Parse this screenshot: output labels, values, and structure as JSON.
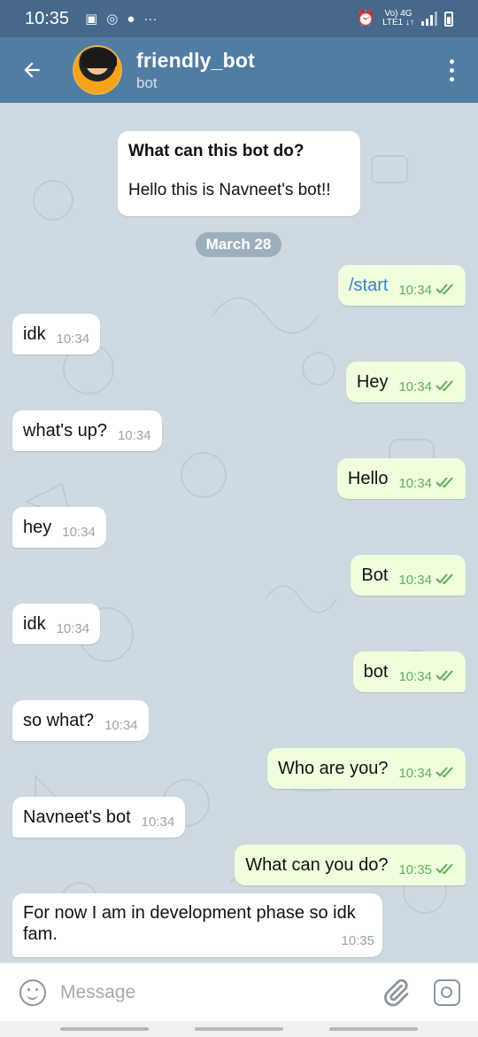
{
  "status_bar": {
    "time": "10:35",
    "network_top": "Vo) 4G",
    "network_bottom": "LTE1 ↓↑"
  },
  "header": {
    "title": "friendly_bot",
    "subtitle": "bot"
  },
  "info_card": {
    "question": "What can this bot do?",
    "answer": "Hello this is Navneet's bot!!"
  },
  "date_separator": "March 28",
  "messages": [
    {
      "text": "/start",
      "time": "10:34",
      "dir": "out"
    },
    {
      "text": "idk",
      "time": "10:34",
      "dir": "in"
    },
    {
      "text": "Hey",
      "time": "10:34",
      "dir": "out"
    },
    {
      "text": "what's up?",
      "time": "10:34",
      "dir": "in"
    },
    {
      "text": "Hello",
      "time": "10:34",
      "dir": "out"
    },
    {
      "text": "hey",
      "time": "10:34",
      "dir": "in"
    },
    {
      "text": "Bot",
      "time": "10:34",
      "dir": "out"
    },
    {
      "text": "idk",
      "time": "10:34",
      "dir": "in"
    },
    {
      "text": "bot",
      "time": "10:34",
      "dir": "out"
    },
    {
      "text": "so what?",
      "time": "10:34",
      "dir": "in"
    },
    {
      "text": "Who are you?",
      "time": "10:34",
      "dir": "out"
    },
    {
      "text": "Navneet's bot",
      "time": "10:34",
      "dir": "in"
    },
    {
      "text": "What can you do?",
      "time": "10:35",
      "dir": "out"
    },
    {
      "text": "For now I am in development phase so idk fam.",
      "time": "10:35",
      "dir": "in"
    }
  ],
  "composer": {
    "placeholder": "Message"
  },
  "colors": {
    "status_bar": "#46688a",
    "app_bar": "#517da2",
    "chat_bg": "#cfd9e2",
    "outgoing_bubble": "#effedd",
    "incoming_bubble": "#ffffff",
    "read_ticks": "#5fae62",
    "command_link": "#3b82c4"
  },
  "icons": {
    "back": "arrow-left-icon",
    "menu": "more-vertical-icon",
    "emoji": "smile-icon",
    "attach": "paperclip-icon",
    "camera": "camera-icon"
  }
}
